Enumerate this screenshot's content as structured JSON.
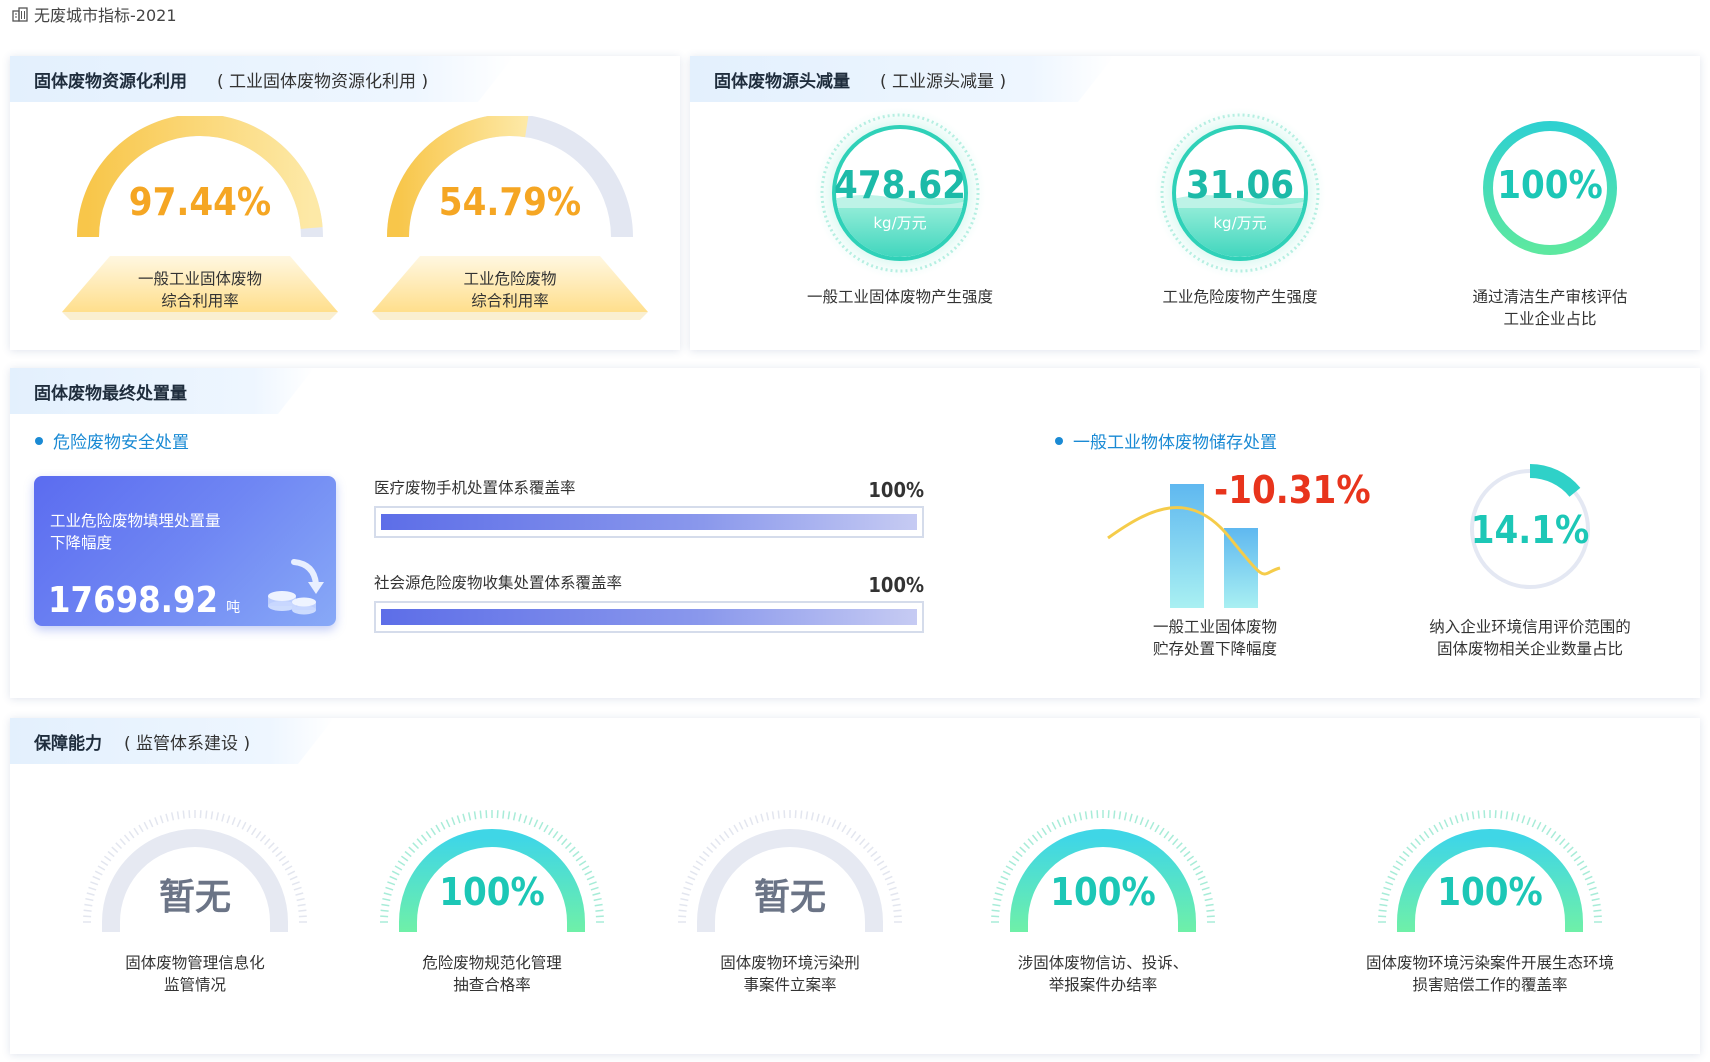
{
  "page": {
    "title": "无废城市指标-2021",
    "title_icon": "building-icon"
  },
  "resource_card": {
    "title": "固体废物资源化利用",
    "subtitle": "( 工业固体废物资源化利用 )",
    "gauges": [
      {
        "value_text": "97.44%",
        "value": 97.44,
        "label_line1": "一般工业固体废物",
        "label_line2": "综合利用率"
      },
      {
        "value_text": "54.79%",
        "value": 54.79,
        "label_line1": "工业危险废物",
        "label_line2": "综合利用率"
      }
    ],
    "colors": {
      "accent": "#f5a623",
      "track": "#e3e7f2"
    }
  },
  "source_card": {
    "title": "固体废物源头减量",
    "subtitle": "( 工业源头减量 )",
    "items": [
      {
        "value": "478.62",
        "unit": "kg/万元",
        "label_line1": "一般工业固体废物产生强度",
        "label_line2": ""
      },
      {
        "value": "31.06",
        "unit": "kg/万元",
        "label_line1": "工业危险废物产生强度",
        "label_line2": ""
      },
      {
        "value": "100%",
        "unit": "",
        "label_line1": "通过清洁生产审核评估",
        "label_line2": "工业企业占比"
      }
    ],
    "colors": {
      "teal": "#1cc7b6"
    }
  },
  "disposal_card": {
    "title": "固体废物最终处置量",
    "left_section": "危险废物安全处置",
    "blue_box": {
      "title_line1": "工业危险废物填埋处置量",
      "title_line2": "下降幅度",
      "value": "17698.92",
      "unit": "吨",
      "icon": "coins-down-icon"
    },
    "bars": [
      {
        "label": "医疗废物手机处置体系覆盖率",
        "value_text": "100%",
        "value": 100
      },
      {
        "label": "社会源危险废物收集处置体系覆盖率",
        "value_text": "100%",
        "value": 100
      }
    ],
    "right_section": "一般工业物体废物储存处置",
    "change_value": "-10.31%",
    "change_label_line1": "一般工业固体废物",
    "change_label_line2": "贮存处置下降幅度",
    "ring_value": "14.1%",
    "ring_fraction": 0.141,
    "ring_label_line1": "纳入企业环境信用评价范围的",
    "ring_label_line2": "固体废物相关企业数量占比",
    "colors": {
      "negative": "#e8341c",
      "teal": "#1cc7b6"
    }
  },
  "guarantee_card": {
    "title": "保障能力",
    "subtitle": "( 监管体系建设 )",
    "gauges": [
      {
        "value_text": "暂无",
        "active": false,
        "label_line1": "固体废物管理信息化",
        "label_line2": "监管情况"
      },
      {
        "value_text": "100%",
        "active": true,
        "label_line1": "危险废物规范化管理",
        "label_line2": "抽查合格率"
      },
      {
        "value_text": "暂无",
        "active": false,
        "label_line1": "固体废物环境污染刑",
        "label_line2": "事案件立案率"
      },
      {
        "value_text": "100%",
        "active": true,
        "label_line1": "涉固体废物信访、投诉、",
        "label_line2": "举报案件办结率"
      },
      {
        "value_text": "100%",
        "active": true,
        "label_line1": "固体废物环境污染案件开展生态环境",
        "label_line2": "损害赔偿工作的覆盖率"
      }
    ]
  }
}
